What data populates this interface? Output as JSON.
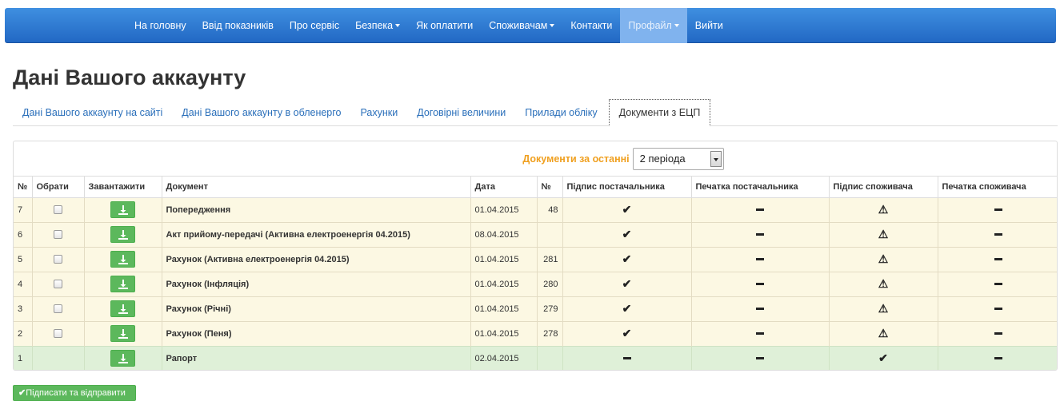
{
  "nav": {
    "items": [
      {
        "label": "На головну",
        "dropdown": false,
        "active": false
      },
      {
        "label": "Ввід показників",
        "dropdown": false,
        "active": false
      },
      {
        "label": "Про сервіс",
        "dropdown": false,
        "active": false
      },
      {
        "label": "Безпека",
        "dropdown": true,
        "active": false
      },
      {
        "label": "Як оплатити",
        "dropdown": false,
        "active": false
      },
      {
        "label": "Споживачам",
        "dropdown": true,
        "active": false
      },
      {
        "label": "Контакти",
        "dropdown": false,
        "active": false
      },
      {
        "label": "Профайл",
        "dropdown": true,
        "active": true
      },
      {
        "label": "Вийти",
        "dropdown": false,
        "active": false
      }
    ]
  },
  "page": {
    "title": "Дані Вашого аккаунту"
  },
  "tabs": [
    {
      "label": "Дані Вашого аккаунту на сайті",
      "active": false
    },
    {
      "label": "Дані Вашого аккаунту в обленерго",
      "active": false
    },
    {
      "label": "Рахунки",
      "active": false
    },
    {
      "label": "Договірні величини",
      "active": false
    },
    {
      "label": "Прилади обліку",
      "active": false
    },
    {
      "label": "Документи з ЕЦП",
      "active": true
    }
  ],
  "filter": {
    "label": "Документи за останні",
    "selected": "2 періода"
  },
  "table": {
    "columns": [
      "№",
      "Обрати",
      "Завантажити",
      "Документ",
      "Дата",
      "№",
      "Підпис постачальника",
      "Печатка постачальника",
      "Підпис споживача",
      "Печатка споживача"
    ],
    "rows": [
      {
        "n": "7",
        "selectable": true,
        "doc": "Попередження",
        "date": "01.04.2015",
        "num": "48",
        "sup_sign": "check",
        "sup_stamp": "dash",
        "cons_sign": "warn",
        "cons_stamp": "dash",
        "status": "warn"
      },
      {
        "n": "6",
        "selectable": true,
        "doc": "Акт прийому-передачі (Активна електроенергія 04.2015)",
        "date": "08.04.2015",
        "num": "",
        "sup_sign": "check",
        "sup_stamp": "dash",
        "cons_sign": "warn",
        "cons_stamp": "dash",
        "status": "warn"
      },
      {
        "n": "5",
        "selectable": true,
        "doc": "Рахунок (Активна електроенергія 04.2015)",
        "date": "01.04.2015",
        "num": "281",
        "sup_sign": "check",
        "sup_stamp": "dash",
        "cons_sign": "warn",
        "cons_stamp": "dash",
        "status": "warn"
      },
      {
        "n": "4",
        "selectable": true,
        "doc": "Рахунок (Інфляція)",
        "date": "01.04.2015",
        "num": "280",
        "sup_sign": "check",
        "sup_stamp": "dash",
        "cons_sign": "warn",
        "cons_stamp": "dash",
        "status": "warn"
      },
      {
        "n": "3",
        "selectable": true,
        "doc": "Рахунок (Річні)",
        "date": "01.04.2015",
        "num": "279",
        "sup_sign": "check",
        "sup_stamp": "dash",
        "cons_sign": "warn",
        "cons_stamp": "dash",
        "status": "warn"
      },
      {
        "n": "2",
        "selectable": true,
        "doc": "Рахунок (Пеня)",
        "date": "01.04.2015",
        "num": "278",
        "sup_sign": "check",
        "sup_stamp": "dash",
        "cons_sign": "warn",
        "cons_stamp": "dash",
        "status": "warn"
      },
      {
        "n": "1",
        "selectable": false,
        "doc": "Рапорт",
        "date": "02.04.2015",
        "num": "",
        "sup_sign": "dash",
        "sup_stamp": "dash",
        "cons_sign": "check",
        "cons_stamp": "dash",
        "status": "ok"
      }
    ]
  },
  "actions": {
    "sign_send_label": "Підписати та відправити"
  },
  "colors": {
    "nav": "#2a74d0",
    "accent": "#f0a020",
    "success": "#5cb85c",
    "warning_row": "#fcf8e3",
    "success_row": "#dff0d8"
  }
}
